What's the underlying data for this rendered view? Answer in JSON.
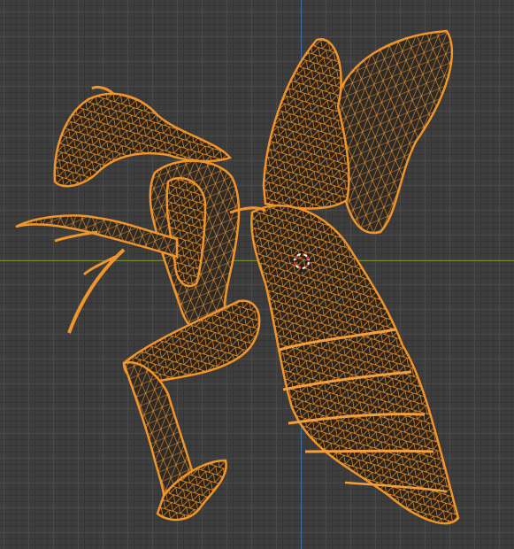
{
  "viewport": {
    "mode": "wireframe",
    "object": "creature-mesh"
  },
  "colors": {
    "background": "#3d3d3d",
    "grid_major": "#4a4a4a",
    "grid_minor": "#353535",
    "x_axis": "#6e8a2a",
    "z_axis": "#3f6fa8",
    "wire": "#f0952c",
    "wire_fill": "#c77a26",
    "cursor_red": "#e23b3b",
    "cursor_white": "#ffffff"
  },
  "icons": {
    "cursor": "3d-cursor-icon"
  }
}
